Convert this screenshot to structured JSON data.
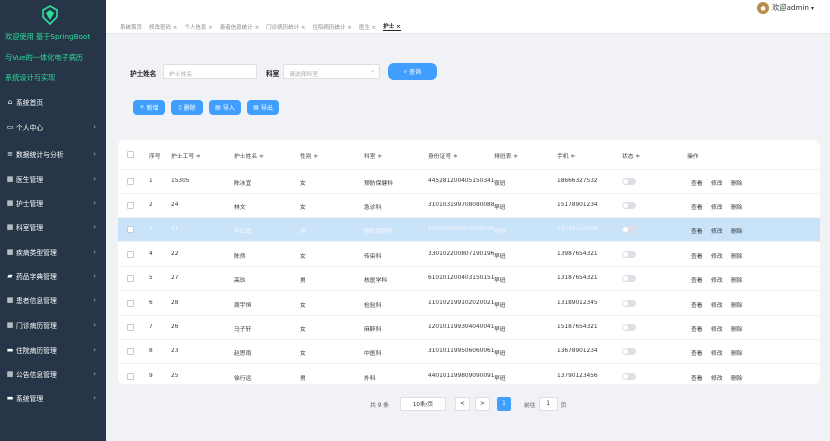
{
  "app": {
    "title_lines": [
      "欢迎使用 基于SpringBoot",
      "与Vue的一体化电子病历",
      "系统设计与实现"
    ]
  },
  "sidebar": {
    "items": [
      {
        "label": "系统首页",
        "icon": "home-icon",
        "glyph": "⌂",
        "chevron": false
      },
      {
        "label": "个人中心",
        "icon": "user-icon",
        "glyph": "▭",
        "chevron": true
      },
      {
        "label": "数据统计与分析",
        "icon": "chart-icon",
        "glyph": "≡",
        "chevron": true
      },
      {
        "label": "医生管理",
        "icon": "grid-icon",
        "glyph": "▦",
        "chevron": true
      },
      {
        "label": "护士管理",
        "icon": "grid-icon",
        "glyph": "▦",
        "chevron": true
      },
      {
        "label": "科室管理",
        "icon": "grid-icon",
        "glyph": "▦",
        "chevron": true
      },
      {
        "label": "疾病类型管理",
        "icon": "grid-icon",
        "glyph": "▦",
        "chevron": true
      },
      {
        "label": "药品字典管理",
        "icon": "pill-icon",
        "glyph": "▰",
        "chevron": true
      },
      {
        "label": "患者信息管理",
        "icon": "grid-icon",
        "glyph": "▦",
        "chevron": true
      },
      {
        "label": "门诊病历管理",
        "icon": "grid-icon",
        "glyph": "▦",
        "chevron": true
      },
      {
        "label": "住院病历管理",
        "icon": "monitor-icon",
        "glyph": "▬",
        "chevron": true
      },
      {
        "label": "公告信息管理",
        "icon": "grid-icon",
        "glyph": "▦",
        "chevron": true
      },
      {
        "label": "系统管理",
        "icon": "system-icon",
        "glyph": "▬",
        "chevron": true
      }
    ]
  },
  "header": {
    "user_label": "欢迎admin",
    "dropdown_glyph": "▾"
  },
  "tabs": [
    "系统首页",
    "修改密码 ×",
    "个人信息 ×",
    "患者信息统计 ×",
    "门诊病历统计 ×",
    "住院病历统计 ×",
    "医生 ×",
    "护士 ×"
  ],
  "search": {
    "name_label": "护士姓名",
    "name_placeholder": "护士姓名",
    "dept_label": "科室",
    "dept_placeholder": "请选择科室",
    "search_button": "查询"
  },
  "toolbar": {
    "add": "新增",
    "delete": "删除",
    "import": "导入",
    "export": "导出"
  },
  "table": {
    "headers": [
      "序号",
      "护士工号 ≑",
      "护士姓名 ≑",
      "性别 ≑",
      "科室 ≑",
      "身份证号 ≑",
      "排班表 ≑",
      "手机 ≑",
      "状态 ≑",
      "操作"
    ],
    "rows": [
      [
        "1",
        "15305",
        "陈冰宜",
        "女",
        "预防保健科",
        "445281200405150341",
        "夜班",
        "18666327532"
      ],
      [
        "2",
        "24",
        "林文",
        "女",
        "急诊科",
        "310103199708080088",
        "早班",
        "15178901234"
      ],
      [
        "3",
        "21",
        "李红霞",
        "男",
        "预防保健科",
        "610102200604010316",
        "早班",
        "13729123456"
      ],
      [
        "4",
        "22",
        "陈然",
        "女",
        "传染科",
        "330102200807190196",
        "早班",
        "13987654321"
      ],
      [
        "5",
        "27",
        "高玖",
        "男",
        "核医学科",
        "610101200403150151",
        "早班",
        "13187654321"
      ],
      [
        "6",
        "28",
        "周宇恒",
        "女",
        "检验科",
        "110102199102020021",
        "早班",
        "13189012345"
      ],
      [
        "7",
        "26",
        "马子轩",
        "女",
        "麻醉科",
        "120101199304040041",
        "早班",
        "15187654321"
      ],
      [
        "8",
        "23",
        "赵思雨",
        "女",
        "中医科",
        "310101199506060061",
        "早班",
        "13678901234"
      ],
      [
        "9",
        "25",
        "徐行远",
        "男",
        "外科",
        "440101199809090091",
        "早班",
        "13790123456"
      ]
    ],
    "actions": [
      "查看",
      "修改",
      "删除"
    ],
    "selected_row_index": 2
  },
  "pagination": {
    "total": "共 9 条",
    "page_size": "10条/页",
    "prev": "<",
    "next": ">",
    "current": "1",
    "goto_label": "前往",
    "goto_value": "1",
    "page_suffix": "页"
  },
  "colors": {
    "sidebar_bg": "#263547",
    "title_green": "#2ddf9d",
    "primary": "#409eff",
    "selected_row": "#c9e3f9"
  }
}
